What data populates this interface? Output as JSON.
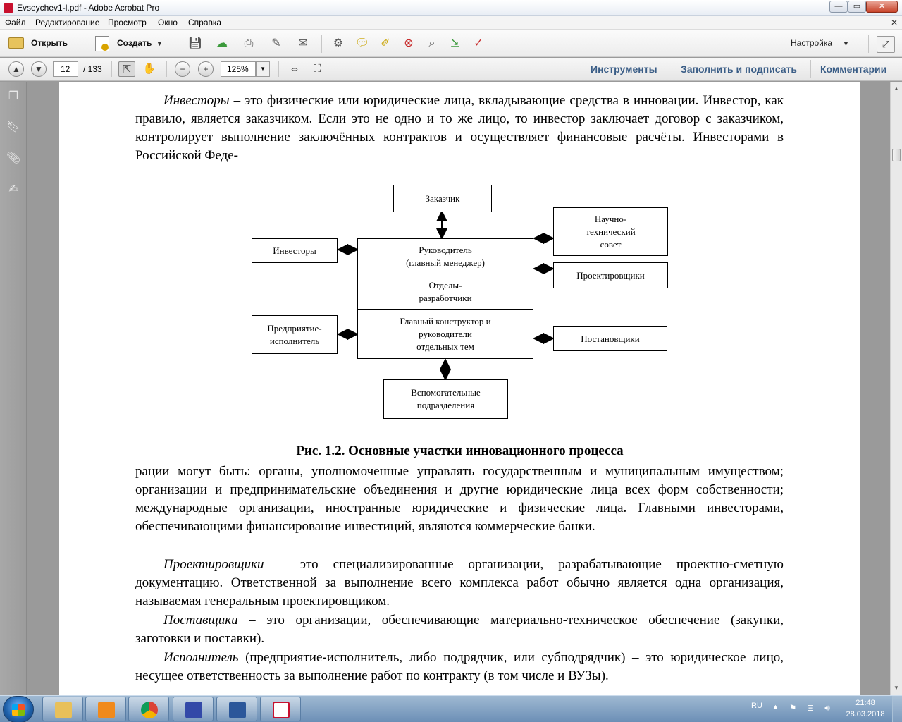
{
  "window": {
    "title": "Evseychev1-l.pdf - Adobe Acrobat Pro",
    "close_glyph": "✕",
    "min_glyph": "—",
    "max_glyph": "▭"
  },
  "menu": {
    "items": [
      "Файл",
      "Редактирование",
      "Просмотр",
      "Окно",
      "Справка"
    ],
    "close": "✕"
  },
  "toolbar": {
    "open": "Открыть",
    "create": "Создать",
    "customize": "Настройка",
    "icons": [
      "save-icon",
      "upload-icon",
      "print-icon",
      "edit-icon",
      "mail-icon",
      "gear-icon",
      "comment-icon",
      "highlight-icon",
      "delete-icon",
      "attach-icon",
      "export-icon",
      "stamp-icon"
    ]
  },
  "navigation": {
    "page_current": "12",
    "page_total": "/ 133",
    "zoom": "125%"
  },
  "panes": {
    "tools": "Инструменты",
    "fill_sign": "Заполнить и подписать",
    "comments": "Комментарии"
  },
  "document": {
    "para1_italic": "Инвесторы",
    "para1_text": " – это физические или юридические лица, вкладывающие средства в инновации. Инвестор, как правило, является заказчиком. Если это не одно и то же лицо, то инвестор заключает договор с заказчиком, контролирует выполнение заключённых контрактов и осуществляет финансовые расчёты.  Инвесторами в Российской Феде-",
    "diagram": {
      "customer": "Заказчик",
      "council": [
        "Научно-",
        "технический",
        "совет"
      ],
      "investors": "Инвесторы",
      "manager": [
        "Руководитель",
        "(главный менеджер)"
      ],
      "designers": "Проектировщики",
      "departments": [
        "Отделы-",
        "разработчики"
      ],
      "contractor": [
        "Предприятие-",
        "исполнитель"
      ],
      "chief_designer": [
        "Главный конструктор и",
        "руководители",
        "отдельных тем"
      ],
      "suppliers": "Постановщики",
      "auxiliary": [
        "Вспомогательные",
        "подразделения"
      ]
    },
    "caption": "Рис. 1.2. Основные участки инновационного процесса",
    "para2_text": "рации могут быть: органы, уполномоченные управлять государственным и муниципальным имуществом; организации и предпринимательские объединения и другие юридические лица всех форм собственности; международные организации, иностранные юридические и физические лица. Главными инвесторами, обеспечивающими финансирование инвестиций, являются коммерческие банки.",
    "para3_italic": "Проектировщики",
    "para3_text": " – это специализированные организации, разрабатывающие проектно-сметную документацию. Ответственной за выполнение всего комплекса работ обычно является одна организация, называемая генеральным проектировщиком.",
    "para4_italic": "Поставщики",
    "para4_text": " – это организации, обеспечивающие материально-техническое обеспечение (закупки, заготовки и поставки).",
    "para5_italic": "Исполнитель",
    "para5_text": " (предприятие-исполнитель, либо подрядчик, или субподрядчик) – это юридическое лицо, несущее ответственность за выполнение работ по контракту (в том числе и ВУЗы)."
  },
  "taskbar": {
    "apps": [
      "explorer",
      "media-player",
      "chrome",
      "save-app",
      "word",
      "acrobat"
    ],
    "lang": "RU",
    "time": "21:48",
    "date": "28.03.2018"
  },
  "colors": {
    "pane_tab": "#3a5d86",
    "taskbar": "#6c8fb6",
    "acrobat_red": "#c8102e"
  }
}
